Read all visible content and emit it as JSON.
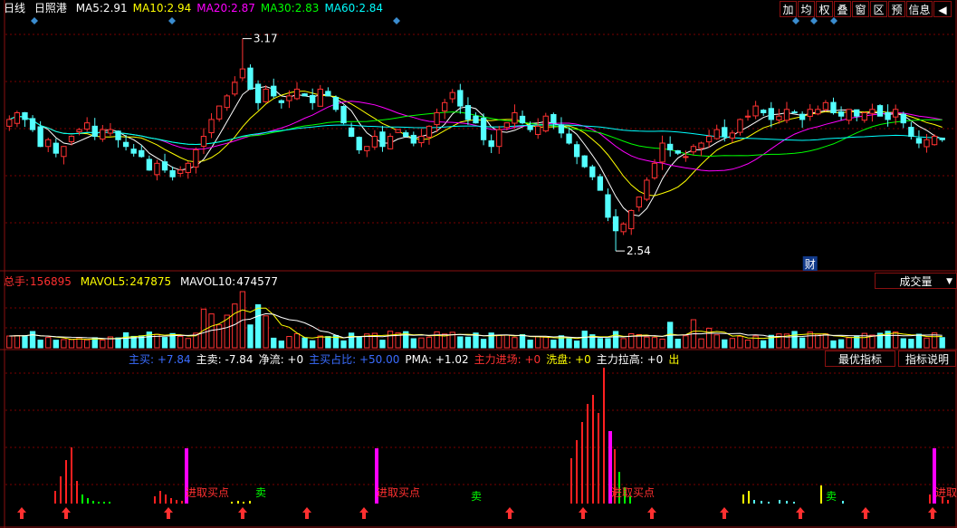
{
  "header": {
    "period": "日线",
    "stock_name": "日照港",
    "ma": [
      {
        "label": "MA5:",
        "value": "2.91",
        "color": "#ffffff"
      },
      {
        "label": "MA10:",
        "value": "2.94",
        "color": "#ffff00"
      },
      {
        "label": "MA20:",
        "value": "2.87",
        "color": "#ff00ff"
      },
      {
        "label": "MA30:",
        "value": "2.83",
        "color": "#00ff00"
      },
      {
        "label": "MA60:",
        "value": "2.84",
        "color": "#00ffff"
      }
    ]
  },
  "toolbar": [
    "加",
    "均",
    "权",
    "叠",
    "窗",
    "区",
    "预",
    "信息",
    "◀"
  ],
  "volume_header": {
    "total": {
      "label": "总手:",
      "value": "156895"
    },
    "mavol5": {
      "label": "MAVOL5:",
      "value": "247875"
    },
    "mavol10": {
      "label": "MAVOL10:",
      "value": "474577"
    },
    "button": "成交量"
  },
  "indicator_header": {
    "items": [
      {
        "label": "主买:",
        "value": "+7.84",
        "color": "#3a6cff"
      },
      {
        "label": "主卖:",
        "value": "-7.84",
        "color": "#ffffff"
      },
      {
        "label": "净流:",
        "value": "+0",
        "color": "#ffffff"
      },
      {
        "label": "主买占比:",
        "value": "+50.00",
        "color": "#3a6cff"
      },
      {
        "label": "PMA:",
        "value": "+1.02",
        "color": "#ffffff"
      },
      {
        "label": "主力进场:",
        "value": "+0",
        "color": "#ff3030"
      },
      {
        "label": "洗盘:",
        "value": "+0",
        "color": "#ffff00"
      },
      {
        "label": "主力拉高:",
        "value": "+0",
        "color": "#ffffff"
      },
      {
        "label": "出",
        "value": "",
        "color": "#ffff00"
      }
    ],
    "buttons": [
      "最优指标",
      "指标说明"
    ]
  },
  "colors": {
    "up": "#ff3232",
    "down": "#54ffff",
    "grid": "#7a0000",
    "border": "#8a1010"
  },
  "chart_data": {
    "type": "candlestick",
    "title": "日照港",
    "price_range": [
      2.54,
      3.17
    ],
    "annotations": {
      "high": "3.17",
      "low": "2.54",
      "event_marker": "财",
      "buy_signal": "进取买点",
      "sell_signal": "卖"
    },
    "close": [
      2.93,
      2.95,
      2.93,
      2.9,
      2.85,
      2.87,
      2.83,
      2.85,
      2.88,
      2.9,
      2.92,
      2.88,
      2.9,
      2.9,
      2.87,
      2.85,
      2.83,
      2.82,
      2.78,
      2.8,
      2.78,
      2.76,
      2.78,
      2.8,
      2.84,
      2.88,
      2.93,
      2.97,
      3.0,
      3.04,
      3.08,
      3.02,
      2.98,
      3.02,
      3.0,
      2.98,
      3.0,
      3.02,
      3.0,
      2.98,
      3.02,
      3.0,
      2.96,
      2.92,
      2.88,
      2.84,
      2.85,
      2.88,
      2.85,
      2.88,
      2.9,
      2.88,
      2.86,
      2.88,
      2.91,
      2.95,
      2.98,
      3.01,
      2.97,
      2.93,
      2.92,
      2.87,
      2.85,
      2.9,
      2.92,
      2.95,
      2.92,
      2.9,
      2.91,
      2.94,
      2.92,
      2.89,
      2.86,
      2.82,
      2.79,
      2.76,
      2.72,
      2.64,
      2.6,
      2.62,
      2.66,
      2.7,
      2.75,
      2.8,
      2.86,
      2.84,
      2.83,
      2.82,
      2.85,
      2.86,
      2.88,
      2.9,
      2.88,
      2.89,
      2.93,
      2.94,
      2.97,
      2.95,
      2.93,
      2.94,
      2.96,
      2.95,
      2.93,
      2.96,
      2.96,
      2.98,
      2.95,
      2.94,
      2.96,
      2.94,
      2.95,
      2.96,
      2.94,
      2.93,
      2.96,
      2.92,
      2.88,
      2.86,
      2.87,
      2.88,
      2.87
    ]
  }
}
